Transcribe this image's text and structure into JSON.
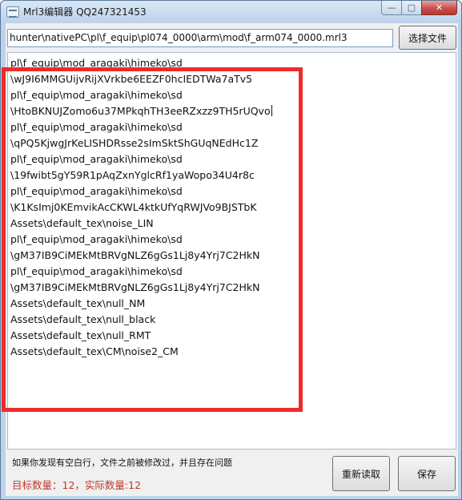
{
  "window": {
    "title": "Mrl3编辑器 QQ247321453",
    "controls": {
      "minimize": "—",
      "maximize": "▢",
      "close": "✕"
    }
  },
  "file": {
    "path": "hunter\\nativePC\\pl\\f_equip\\pl074_0000\\arm\\mod\\f_arm074_0000.mrl3",
    "choose_label": "选择文件"
  },
  "editor": {
    "lines": [
      "pl\\f_equip\\mod_aragaki\\himeko\\sd",
      "\\wJ9I6MMGUijvRijXVrkbe6EEZF0hcIEDTWa7aTv5",
      "pl\\f_equip\\mod_aragaki\\himeko\\sd",
      "\\HtoBKNUJZomo6u37MPkqhTH3eeRZxzz9TH5rUQvo",
      "pl\\f_equip\\mod_aragaki\\himeko\\sd",
      "\\qPQ5KjwgJrKeLISHDRsse2sImSktShGUqNEdHc1Z",
      "pl\\f_equip\\mod_aragaki\\himeko\\sd",
      "\\19fwibt5gY59R1pAqZxnYglcRf1yaWopo34U4r8c",
      "pl\\f_equip\\mod_aragaki\\himeko\\sd",
      "\\K1KsImj0KEmvikAcCKWL4ktkUfYqRWJVo9BJSTbK",
      "Assets\\default_tex\\noise_LIN",
      "pl\\f_equip\\mod_aragaki\\himeko\\sd",
      "\\gM37IB9CiMEkMtBRVgNLZ6gGs1Lj8y4Yrj7C2HkN",
      "pl\\f_equip\\mod_aragaki\\himeko\\sd",
      "\\gM37IB9CiMEkMtBRVgNLZ6gGs1Lj8y4Yrj7C2HkN",
      "Assets\\default_tex\\null_NM",
      "Assets\\default_tex\\null_black",
      "Assets\\default_tex\\null_RMT",
      "Assets\\default_tex\\CM\\noise2_CM"
    ]
  },
  "status": {
    "warning": "如果你发现有空白行，文件之前被修改过，并且存在问题",
    "counts": "目标数量：12，实际数量:12"
  },
  "buttons": {
    "reload_label": "重新读取",
    "save_label": "保存"
  },
  "colors": {
    "highlight": "#ee2b2b",
    "count_text": "#c0392b",
    "close_button": "#c75050"
  }
}
